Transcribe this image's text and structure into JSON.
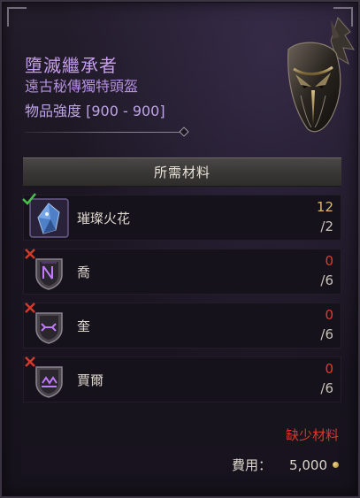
{
  "item": {
    "name": "墮滅繼承者",
    "type": "遠古秘傳獨特頭盔",
    "power": "物品強度 [900 - 900]"
  },
  "materials_header": "所需材料",
  "materials": [
    {
      "name": "璀璨火花",
      "have": "12",
      "need": "/2",
      "status": "ok",
      "icon": "crystal-icon"
    },
    {
      "name": "喬",
      "have": "0",
      "need": "/6",
      "status": "missing",
      "icon": "rune-icon"
    },
    {
      "name": "奎",
      "have": "0",
      "need": "/6",
      "status": "missing",
      "icon": "rune-icon"
    },
    {
      "name": "賈爾",
      "have": "0",
      "need": "/6",
      "status": "missing",
      "icon": "rune-icon"
    }
  ],
  "missing_label": "缺少材料",
  "cost": {
    "label": "費用：",
    "value": "5,000"
  },
  "colors": {
    "title": "#c79ef0",
    "ok": "#e0b870",
    "missing": "#e23b2a",
    "rune_glow": "#b060ff"
  }
}
